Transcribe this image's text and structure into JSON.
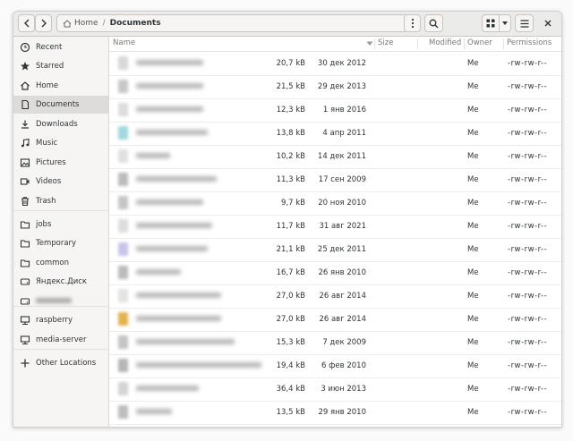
{
  "header": {
    "path": [
      {
        "label": "Home",
        "icon": "home-icon"
      },
      {
        "label": "Documents"
      }
    ],
    "separator": "/"
  },
  "sidebar": {
    "items": [
      {
        "label": "Recent",
        "icon": "clock-icon"
      },
      {
        "label": "Starred",
        "icon": "star-icon"
      },
      {
        "label": "Home",
        "icon": "home-icon"
      },
      {
        "label": "Documents",
        "icon": "document-icon",
        "active": true
      },
      {
        "label": "Downloads",
        "icon": "download-icon"
      },
      {
        "label": "Music",
        "icon": "music-icon"
      },
      {
        "label": "Pictures",
        "icon": "picture-icon"
      },
      {
        "label": "Videos",
        "icon": "video-icon"
      },
      {
        "label": "Trash",
        "icon": "trash-icon"
      },
      {
        "label": "jobs",
        "icon": "folder-icon"
      },
      {
        "label": "Temporary",
        "icon": "folder-icon"
      },
      {
        "label": "common",
        "icon": "folder-icon"
      },
      {
        "label": "Яндекс.Диск",
        "icon": "drive-icon"
      },
      {
        "label": "",
        "icon": "drive-icon",
        "blurred": true
      },
      {
        "label": "raspberry",
        "icon": "network-icon"
      },
      {
        "label": "media-server",
        "icon": "network-icon"
      },
      {
        "label": "Other Locations",
        "icon": "plus-icon"
      }
    ]
  },
  "columns": {
    "name": "Name",
    "size": "Size",
    "modified": "Modified",
    "owner": "Owner",
    "permissions": "Permissions"
  },
  "files": [
    {
      "size": "20,7 kB",
      "modified": "30 дек 2012",
      "owner": "Me",
      "permissions": "-rw-rw-r--"
    },
    {
      "size": "21,5 kB",
      "modified": "29 дек 2013",
      "owner": "Me",
      "permissions": "-rw-rw-r--"
    },
    {
      "size": "12,3 kB",
      "modified": "1 янв 2016",
      "owner": "Me",
      "permissions": "-rw-rw-r--"
    },
    {
      "size": "13,8 kB",
      "modified": "4 апр 2011",
      "owner": "Me",
      "permissions": "-rw-rw-r--"
    },
    {
      "size": "10,2 kB",
      "modified": "14 дек 2011",
      "owner": "Me",
      "permissions": "-rw-rw-r--"
    },
    {
      "size": "11,3 kB",
      "modified": "17 сен 2009",
      "owner": "Me",
      "permissions": "-rw-rw-r--"
    },
    {
      "size": "9,7 kB",
      "modified": "20 ноя 2010",
      "owner": "Me",
      "permissions": "-rw-rw-r--"
    },
    {
      "size": "11,7 kB",
      "modified": "31 авг 2021",
      "owner": "Me",
      "permissions": "-rw-rw-r--"
    },
    {
      "size": "21,1 kB",
      "modified": "25 дек 2011",
      "owner": "Me",
      "permissions": "-rw-rw-r--"
    },
    {
      "size": "16,7 kB",
      "modified": "26 янв 2010",
      "owner": "Me",
      "permissions": "-rw-rw-r--"
    },
    {
      "size": "27,0 kB",
      "modified": "26 авг 2014",
      "owner": "Me",
      "permissions": "-rw-rw-r--"
    },
    {
      "size": "27,0 kB",
      "modified": "26 авг 2014",
      "owner": "Me",
      "permissions": "-rw-rw-r--"
    },
    {
      "size": "15,3 kB",
      "modified": "7 дек 2009",
      "owner": "Me",
      "permissions": "-rw-rw-r--"
    },
    {
      "size": "19,4 kB",
      "modified": "6 фев 2010",
      "owner": "Me",
      "permissions": "-rw-rw-r--"
    },
    {
      "size": "36,4 kB",
      "modified": "3 июн 2013",
      "owner": "Me",
      "permissions": "-rw-rw-r--"
    },
    {
      "size": "13,5 kB",
      "modified": "29 янв 2010",
      "owner": "Me",
      "permissions": "-rw-rw-r--"
    }
  ],
  "colors": {
    "accent": "#2e3436",
    "sidebar_bg": "#f6f5f4",
    "header_bg": "#ebebea",
    "active_item_bg": "#dedcda"
  }
}
